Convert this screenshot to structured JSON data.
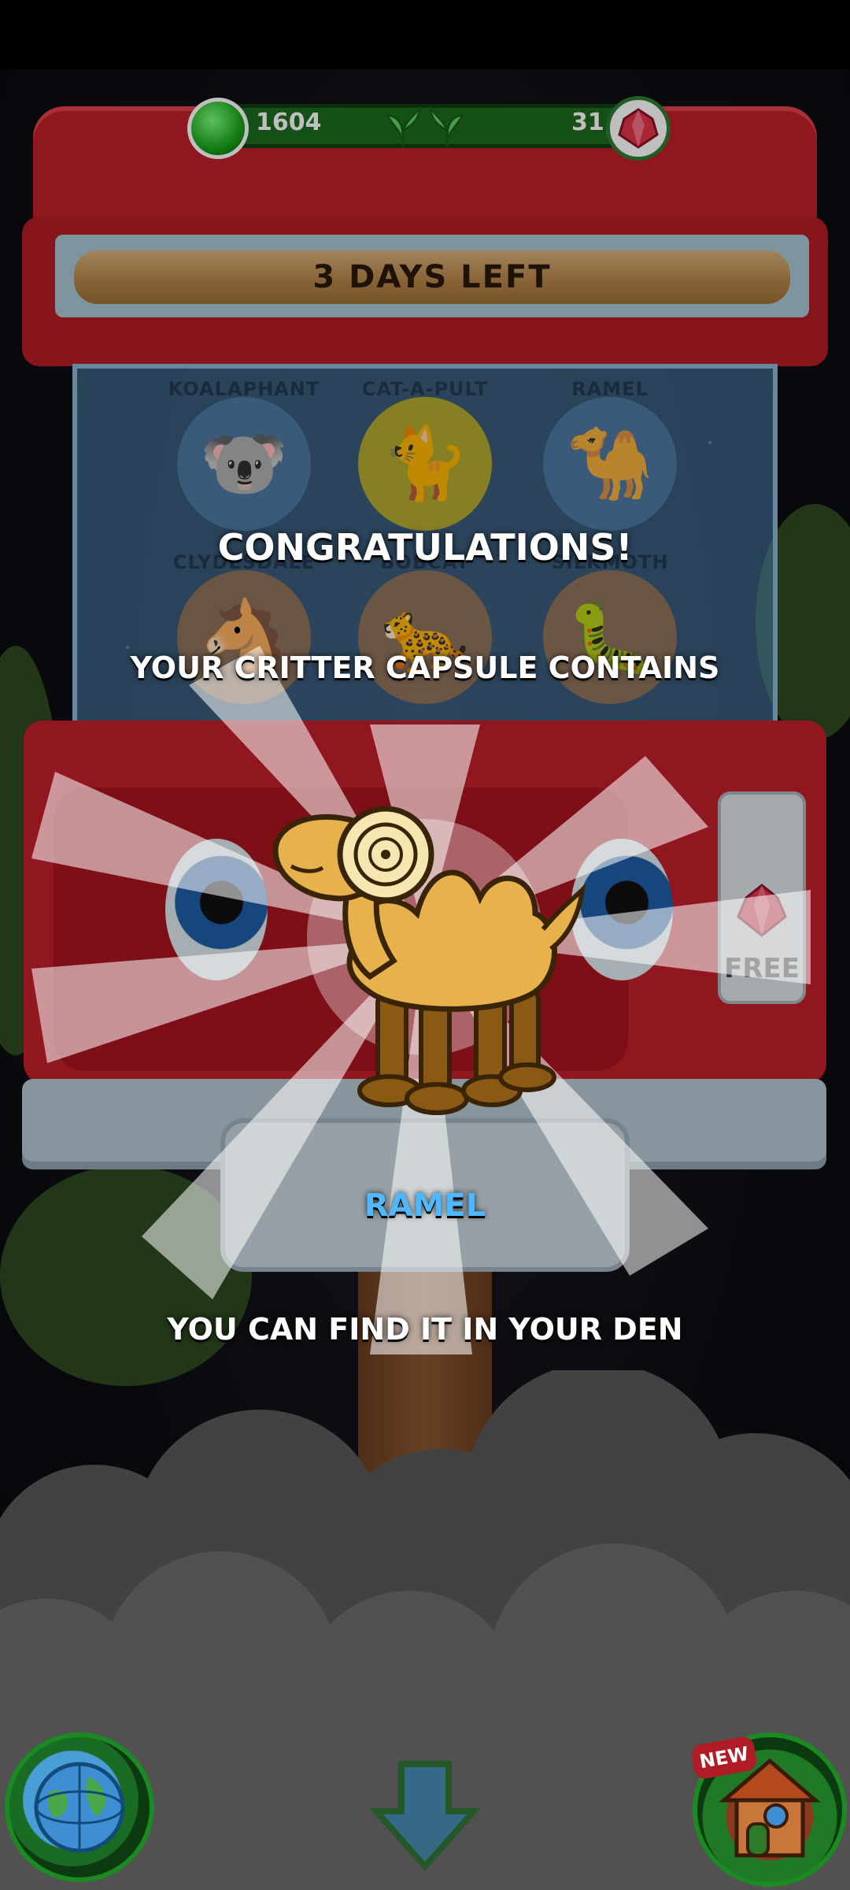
{
  "currency": {
    "gems": "1604",
    "rubies": "31"
  },
  "banner": {
    "text": "3 DAYS LEFT"
  },
  "critters": [
    {
      "name": "KOALAPHANT",
      "icon": "koalaphant-icon",
      "art": "🐨",
      "style": "blue"
    },
    {
      "name": "CAT-A-PULT",
      "icon": "cat-a-pult-icon",
      "art": "🐈",
      "style": "gold"
    },
    {
      "name": "RAMEL",
      "icon": "ramel-icon",
      "art": "🐪",
      "style": "blue"
    },
    {
      "name": "CLYDESDALE",
      "icon": "clydesdale-icon",
      "art": "🐴",
      "style": "orange"
    },
    {
      "name": "BOBCAT",
      "icon": "bobcat-icon",
      "art": "🐆",
      "style": "orange"
    },
    {
      "name": "SILKMOTH",
      "icon": "silkmoth-icon",
      "art": "🐛",
      "style": "orange"
    }
  ],
  "slot": {
    "free_label": "FREE"
  },
  "reward": {
    "title": "CONGRATULATIONS!",
    "subtitle": "YOUR CRITTER CAPSULE CONTAINS",
    "critter_name": "RAMEL",
    "message": "YOU CAN FIND IT IN YOUR DEN"
  },
  "bottom": {
    "new_badge": "NEW"
  },
  "colors": {
    "machine_red": "#c01f2a",
    "currency_green": "#1d6b1f",
    "name_blue": "#4fb8ff"
  }
}
